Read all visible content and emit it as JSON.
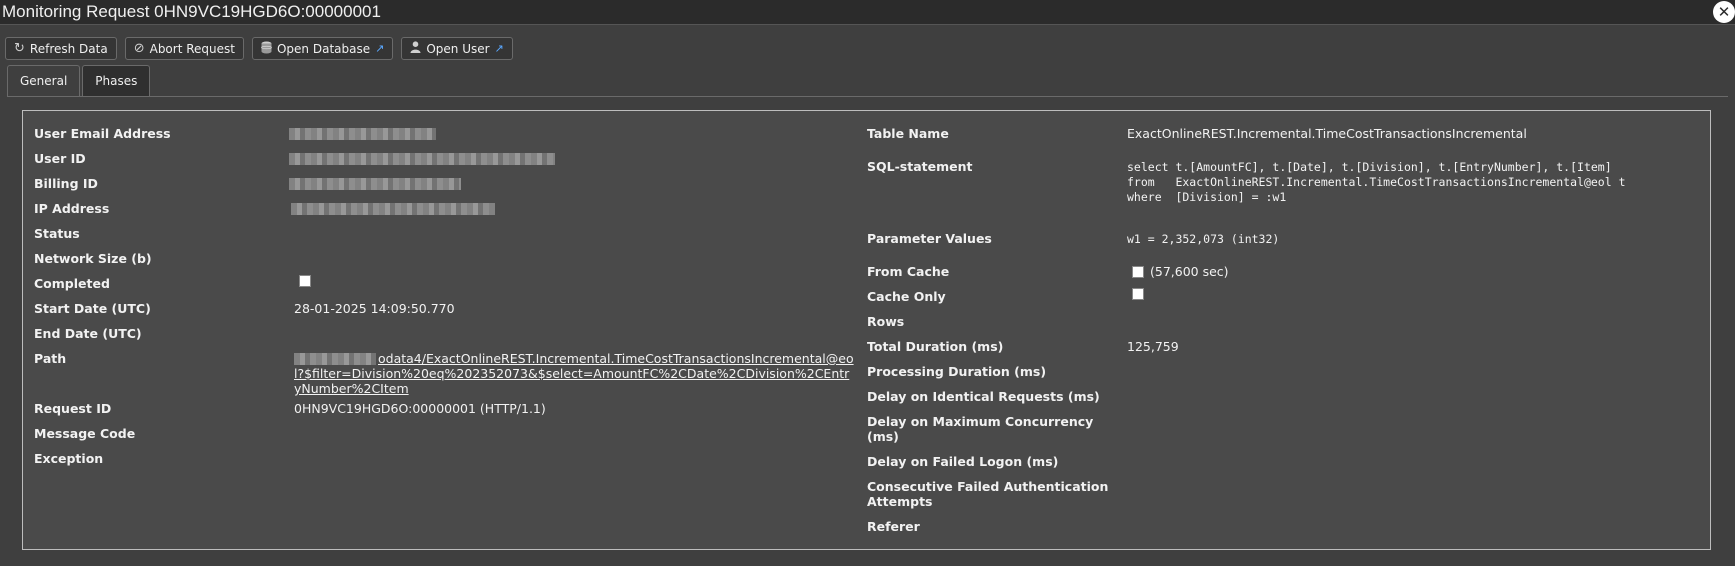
{
  "window": {
    "title": "Monitoring Request 0HN9VC19HGD6O:00000001",
    "close_icon": "✕"
  },
  "toolbar": {
    "refresh_label": "Refresh Data",
    "abort_label": "Abort Request",
    "open_database_label": "Open Database",
    "open_user_label": "Open User"
  },
  "tabs": {
    "general": "General",
    "phases": "Phases"
  },
  "left": {
    "user_email_label": "User Email Address",
    "user_id_label": "User ID",
    "billing_id_label": "Billing ID",
    "ip_address_label": "IP Address",
    "status_label": "Status",
    "network_size_label": "Network Size (b)",
    "completed_label": "Completed",
    "completed_value": false,
    "start_date_label": "Start Date (UTC)",
    "start_date_value": "28-01-2025 14:09:50.770",
    "end_date_label": "End Date (UTC)",
    "path_label": "Path",
    "path_value": "odata4/ExactOnlineREST.Incremental.TimeCostTransactionsIncremental@eol?$filter=Division%20eq%202352073&$select=AmountFC%2CDate%2CDivision%2CEntryNumber%2CItem",
    "request_id_label": "Request ID",
    "request_id_value": "0HN9VC19HGD6O:00000001 (HTTP/1.1)",
    "message_code_label": "Message Code",
    "exception_label": "Exception"
  },
  "right": {
    "table_name_label": "Table Name",
    "table_name_value": "ExactOnlineREST.Incremental.TimeCostTransactionsIncremental",
    "sql_label": "SQL-statement",
    "sql_value": "select t.[AmountFC], t.[Date], t.[Division], t.[EntryNumber], t.[Item]\nfrom   ExactOnlineREST.Incremental.TimeCostTransactionsIncremental@eol t\nwhere  [Division] = :w1",
    "parameter_values_label": "Parameter Values",
    "parameter_values_value": "w1 = 2,352,073 (int32)",
    "from_cache_label": "From Cache",
    "from_cache_value": false,
    "from_cache_note": "(57,600 sec)",
    "cache_only_label": "Cache Only",
    "cache_only_value": false,
    "rows_label": "Rows",
    "total_duration_label": "Total Duration (ms)",
    "total_duration_value": "125,759",
    "processing_duration_label": "Processing Duration (ms)",
    "delay_identical_label": "Delay on Identical Requests (ms)",
    "delay_max_concurrency_label": "Delay on Maximum Concurrency (ms)",
    "delay_failed_logon_label": "Delay on Failed Logon (ms)",
    "consecutive_failed_label": "Consecutive Failed Authentication Attempts",
    "referer_label": "Referer"
  },
  "icons": {
    "refresh": "refresh-icon",
    "abort": "ban-icon",
    "database": "database-icon",
    "user": "user-icon",
    "external": "external-link-icon"
  },
  "colors": {
    "background": "#3f3f3f",
    "content_panel": "#4a4a4a",
    "link_icon": "#5aa8ff"
  }
}
